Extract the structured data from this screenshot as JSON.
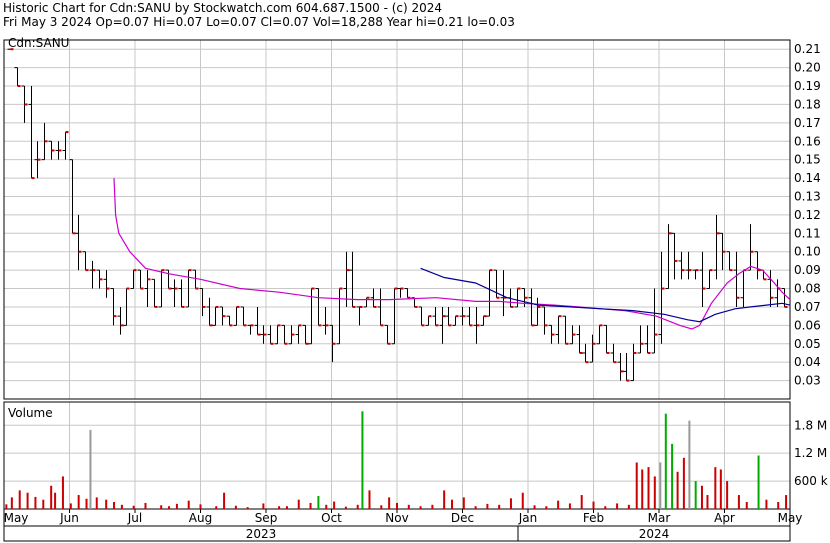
{
  "header": {
    "title": "Historic Chart for Cdn:SANU by Stockwatch.com 604.687.1500 - (c) 2024",
    "summary": "Fri May  3 2024   Op=0.07  Hi=0.07  Lo=0.07  Cl=0.07  Vol=18,288  Year hi=0.21  lo=0.03"
  },
  "chart_data": {
    "type": "ohlc",
    "symbol_label": "Cdn:SANU",
    "volume_label": "Volume",
    "price_ylim": [
      0.02,
      0.215
    ],
    "price_ticks": [
      "0.21",
      "0.20",
      "0.19",
      "0.18",
      "0.17",
      "0.16",
      "0.15",
      "0.14",
      "0.13",
      "0.12",
      "0.11",
      "0.10",
      "0.09",
      "0.08",
      "0.07",
      "0.06",
      "0.05",
      "0.04",
      "0.03"
    ],
    "volume_ticks": [
      "1.8 M",
      "1.2 M",
      "600 k"
    ],
    "volume_ylim": [
      0,
      2300000
    ],
    "month_labels": [
      "May",
      "Jun",
      "Jul",
      "Aug",
      "Sep",
      "Oct",
      "Nov",
      "Dec",
      "Jan",
      "Feb",
      "Mar",
      "Apr",
      "May"
    ],
    "year_labels": [
      "2023",
      "2024"
    ],
    "grid": true,
    "colors": {
      "up": "#000000",
      "down": "#cc0000",
      "ma_short": "#cc00cc",
      "ma_long": "#000099",
      "vol_big": "#00aa00",
      "vol_gray": "#999999",
      "grid": "#c8c8c8"
    },
    "bars": [
      [
        0.21,
        0.21,
        0.21,
        0.21
      ],
      [
        0.2,
        0.2,
        0.19,
        0.19
      ],
      [
        0.19,
        0.19,
        0.17,
        0.18
      ],
      [
        0.18,
        0.19,
        0.14,
        0.14
      ],
      [
        0.15,
        0.16,
        0.14,
        0.15
      ],
      [
        0.15,
        0.17,
        0.15,
        0.16
      ],
      [
        0.16,
        0.16,
        0.15,
        0.155
      ],
      [
        0.155,
        0.16,
        0.15,
        0.155
      ],
      [
        0.155,
        0.165,
        0.15,
        0.165
      ],
      [
        0.15,
        0.15,
        0.11,
        0.11
      ],
      [
        0.11,
        0.12,
        0.09,
        0.1
      ],
      [
        0.1,
        0.1,
        0.09,
        0.09
      ],
      [
        0.09,
        0.095,
        0.08,
        0.09
      ],
      [
        0.09,
        0.09,
        0.08,
        0.085
      ],
      [
        0.085,
        0.09,
        0.075,
        0.08
      ],
      [
        0.08,
        0.08,
        0.06,
        0.065
      ],
      [
        0.065,
        0.07,
        0.055,
        0.06
      ],
      [
        0.06,
        0.08,
        0.06,
        0.08
      ],
      [
        0.08,
        0.09,
        0.08,
        0.09
      ],
      [
        0.09,
        0.09,
        0.08,
        0.08
      ],
      [
        0.08,
        0.09,
        0.07,
        0.085
      ],
      [
        0.085,
        0.085,
        0.07,
        0.07
      ],
      [
        0.07,
        0.09,
        0.07,
        0.09
      ],
      [
        0.09,
        0.09,
        0.08,
        0.08
      ],
      [
        0.08,
        0.085,
        0.07,
        0.08
      ],
      [
        0.08,
        0.085,
        0.07,
        0.07
      ],
      [
        0.07,
        0.09,
        0.07,
        0.09
      ],
      [
        0.09,
        0.09,
        0.08,
        0.08
      ],
      [
        0.08,
        0.08,
        0.065,
        0.07
      ],
      [
        0.07,
        0.075,
        0.06,
        0.06
      ],
      [
        0.06,
        0.07,
        0.06,
        0.07
      ],
      [
        0.07,
        0.07,
        0.06,
        0.065
      ],
      [
        0.065,
        0.065,
        0.06,
        0.06
      ],
      [
        0.06,
        0.07,
        0.06,
        0.07
      ],
      [
        0.07,
        0.07,
        0.06,
        0.06
      ],
      [
        0.06,
        0.06,
        0.055,
        0.06
      ],
      [
        0.06,
        0.07,
        0.055,
        0.055
      ],
      [
        0.055,
        0.06,
        0.05,
        0.055
      ],
      [
        0.055,
        0.06,
        0.05,
        0.05
      ],
      [
        0.05,
        0.06,
        0.05,
        0.06
      ],
      [
        0.06,
        0.06,
        0.05,
        0.05
      ],
      [
        0.05,
        0.06,
        0.05,
        0.055
      ],
      [
        0.055,
        0.06,
        0.05,
        0.06
      ],
      [
        0.06,
        0.06,
        0.05,
        0.05
      ],
      [
        0.05,
        0.08,
        0.05,
        0.08
      ],
      [
        0.08,
        0.08,
        0.06,
        0.06
      ],
      [
        0.06,
        0.07,
        0.055,
        0.06
      ],
      [
        0.06,
        0.06,
        0.04,
        0.05
      ],
      [
        0.05,
        0.08,
        0.05,
        0.08
      ],
      [
        0.08,
        0.1,
        0.07,
        0.09
      ],
      [
        0.09,
        0.1,
        0.07,
        0.07
      ],
      [
        0.07,
        0.07,
        0.06,
        0.07
      ],
      [
        0.07,
        0.075,
        0.07,
        0.075
      ],
      [
        0.075,
        0.08,
        0.07,
        0.07
      ],
      [
        0.07,
        0.08,
        0.06,
        0.06
      ],
      [
        0.06,
        0.06,
        0.05,
        0.05
      ],
      [
        0.05,
        0.08,
        0.05,
        0.08
      ],
      [
        0.08,
        0.08,
        0.075,
        0.08
      ],
      [
        0.08,
        0.08,
        0.075,
        0.075
      ],
      [
        0.075,
        0.075,
        0.07,
        0.07
      ],
      [
        0.07,
        0.07,
        0.06,
        0.06
      ],
      [
        0.06,
        0.065,
        0.06,
        0.065
      ],
      [
        0.065,
        0.07,
        0.06,
        0.06
      ],
      [
        0.06,
        0.07,
        0.05,
        0.065
      ],
      [
        0.065,
        0.07,
        0.06,
        0.06
      ],
      [
        0.06,
        0.065,
        0.06,
        0.065
      ],
      [
        0.065,
        0.07,
        0.06,
        0.065
      ],
      [
        0.065,
        0.07,
        0.06,
        0.06
      ],
      [
        0.06,
        0.07,
        0.05,
        0.06
      ],
      [
        0.06,
        0.065,
        0.06,
        0.065
      ],
      [
        0.065,
        0.09,
        0.065,
        0.09
      ],
      [
        0.09,
        0.09,
        0.075,
        0.075
      ],
      [
        0.075,
        0.09,
        0.065,
        0.075
      ],
      [
        0.075,
        0.08,
        0.07,
        0.07
      ],
      [
        0.07,
        0.08,
        0.07,
        0.08
      ],
      [
        0.08,
        0.08,
        0.07,
        0.075
      ],
      [
        0.075,
        0.08,
        0.06,
        0.06
      ],
      [
        0.06,
        0.075,
        0.06,
        0.07
      ],
      [
        0.07,
        0.07,
        0.055,
        0.06
      ],
      [
        0.06,
        0.06,
        0.05,
        0.055
      ],
      [
        0.055,
        0.065,
        0.05,
        0.065
      ],
      [
        0.065,
        0.065,
        0.05,
        0.05
      ],
      [
        0.05,
        0.06,
        0.05,
        0.055
      ],
      [
        0.055,
        0.06,
        0.045,
        0.045
      ],
      [
        0.045,
        0.05,
        0.04,
        0.04
      ],
      [
        0.04,
        0.055,
        0.04,
        0.05
      ],
      [
        0.05,
        0.06,
        0.05,
        0.06
      ],
      [
        0.06,
        0.06,
        0.045,
        0.045
      ],
      [
        0.045,
        0.05,
        0.04,
        0.04
      ],
      [
        0.04,
        0.045,
        0.03,
        0.035
      ],
      [
        0.035,
        0.045,
        0.03,
        0.03
      ],
      [
        0.03,
        0.05,
        0.03,
        0.045
      ],
      [
        0.045,
        0.06,
        0.045,
        0.05
      ],
      [
        0.05,
        0.06,
        0.045,
        0.045
      ],
      [
        0.045,
        0.08,
        0.045,
        0.055
      ],
      [
        0.055,
        0.1,
        0.05,
        0.08
      ],
      [
        0.08,
        0.115,
        0.08,
        0.11
      ],
      [
        0.11,
        0.11,
        0.085,
        0.095
      ],
      [
        0.095,
        0.1,
        0.085,
        0.09
      ],
      [
        0.09,
        0.1,
        0.085,
        0.09
      ],
      [
        0.09,
        0.09,
        0.085,
        0.09
      ],
      [
        0.09,
        0.1,
        0.07,
        0.08
      ],
      [
        0.08,
        0.09,
        0.08,
        0.09
      ],
      [
        0.09,
        0.12,
        0.085,
        0.11
      ],
      [
        0.11,
        0.11,
        0.09,
        0.1
      ],
      [
        0.1,
        0.1,
        0.09,
        0.09
      ],
      [
        0.09,
        0.1,
        0.07,
        0.075
      ],
      [
        0.075,
        0.09,
        0.07,
        0.09
      ],
      [
        0.09,
        0.115,
        0.09,
        0.1
      ],
      [
        0.1,
        0.1,
        0.085,
        0.09
      ],
      [
        0.09,
        0.09,
        0.085,
        0.085
      ],
      [
        0.085,
        0.09,
        0.07,
        0.075
      ],
      [
        0.075,
        0.085,
        0.07,
        0.08
      ],
      [
        0.08,
        0.08,
        0.07,
        0.07
      ]
    ],
    "ma_short": [
      [
        0.14,
        0.14
      ],
      [
        0.141,
        0.13
      ],
      [
        0.142,
        0.12
      ],
      [
        0.146,
        0.11
      ],
      [
        0.16,
        0.1
      ],
      [
        0.18,
        0.091
      ],
      [
        0.21,
        0.088
      ],
      [
        0.25,
        0.085
      ],
      [
        0.3,
        0.08
      ],
      [
        0.35,
        0.078
      ],
      [
        0.4,
        0.075
      ],
      [
        0.45,
        0.074
      ],
      [
        0.49,
        0.074
      ],
      [
        0.55,
        0.075
      ],
      [
        0.6,
        0.073
      ],
      [
        0.63,
        0.073
      ],
      [
        0.66,
        0.072
      ],
      [
        0.7,
        0.071
      ],
      [
        0.73,
        0.07
      ],
      [
        0.76,
        0.069
      ],
      [
        0.79,
        0.068
      ],
      [
        0.83,
        0.065
      ],
      [
        0.86,
        0.06
      ],
      [
        0.875,
        0.058
      ],
      [
        0.885,
        0.06
      ],
      [
        0.9,
        0.072
      ],
      [
        0.92,
        0.083
      ],
      [
        0.935,
        0.088
      ],
      [
        0.95,
        0.092
      ],
      [
        0.965,
        0.09
      ],
      [
        0.98,
        0.083
      ],
      [
        0.99,
        0.078
      ],
      [
        1.0,
        0.074
      ]
    ],
    "ma_long": [
      [
        0.53,
        0.091
      ],
      [
        0.56,
        0.086
      ],
      [
        0.6,
        0.083
      ],
      [
        0.64,
        0.075
      ],
      [
        0.68,
        0.071
      ],
      [
        0.72,
        0.07
      ],
      [
        0.76,
        0.069
      ],
      [
        0.8,
        0.068
      ],
      [
        0.84,
        0.066
      ],
      [
        0.87,
        0.063
      ],
      [
        0.885,
        0.062
      ],
      [
        0.905,
        0.066
      ],
      [
        0.93,
        0.069
      ],
      [
        0.95,
        0.07
      ],
      [
        0.97,
        0.071
      ],
      [
        0.99,
        0.072
      ],
      [
        1.0,
        0.071
      ]
    ],
    "volume": [
      [
        0.003,
        100000
      ],
      [
        0.01,
        250000
      ],
      [
        0.02,
        400000
      ],
      [
        0.03,
        350000
      ],
      [
        0.04,
        260000
      ],
      [
        0.05,
        200000
      ],
      [
        0.06,
        500000
      ],
      [
        0.065,
        350000
      ],
      [
        0.075,
        700000
      ],
      [
        0.085,
        120000
      ],
      [
        0.095,
        300000
      ],
      [
        0.105,
        220000
      ],
      [
        0.11,
        1700000,
        "gray"
      ],
      [
        0.118,
        250000
      ],
      [
        0.13,
        200000
      ],
      [
        0.14,
        150000
      ],
      [
        0.15,
        90000
      ],
      [
        0.165,
        70000
      ],
      [
        0.18,
        130000
      ],
      [
        0.2,
        80000
      ],
      [
        0.21,
        60000
      ],
      [
        0.22,
        110000
      ],
      [
        0.235,
        180000
      ],
      [
        0.25,
        100000
      ],
      [
        0.27,
        60000
      ],
      [
        0.28,
        350000
      ],
      [
        0.295,
        70000
      ],
      [
        0.31,
        40000
      ],
      [
        0.33,
        120000
      ],
      [
        0.35,
        60000
      ],
      [
        0.36,
        60000
      ],
      [
        0.375,
        200000
      ],
      [
        0.39,
        130000
      ],
      [
        0.4,
        280000,
        "green"
      ],
      [
        0.41,
        90000
      ],
      [
        0.42,
        160000
      ],
      [
        0.435,
        50000
      ],
      [
        0.45,
        90000
      ],
      [
        0.456,
        2100000,
        "green"
      ],
      [
        0.465,
        400000
      ],
      [
        0.48,
        80000
      ],
      [
        0.49,
        250000
      ],
      [
        0.5,
        130000
      ],
      [
        0.515,
        90000
      ],
      [
        0.53,
        60000
      ],
      [
        0.545,
        90000
      ],
      [
        0.56,
        400000
      ],
      [
        0.57,
        200000
      ],
      [
        0.585,
        250000
      ],
      [
        0.6,
        60000
      ],
      [
        0.615,
        110000
      ],
      [
        0.63,
        90000
      ],
      [
        0.645,
        230000
      ],
      [
        0.66,
        350000
      ],
      [
        0.675,
        80000
      ],
      [
        0.69,
        60000
      ],
      [
        0.705,
        180000
      ],
      [
        0.72,
        120000
      ],
      [
        0.735,
        300000
      ],
      [
        0.75,
        160000
      ],
      [
        0.765,
        60000
      ],
      [
        0.78,
        120000
      ],
      [
        0.795,
        90000
      ],
      [
        0.805,
        1000000
      ],
      [
        0.812,
        850000
      ],
      [
        0.82,
        900000
      ],
      [
        0.828,
        700000
      ],
      [
        0.835,
        1000000,
        "gray"
      ],
      [
        0.842,
        2050000,
        "green"
      ],
      [
        0.85,
        1400000,
        "green"
      ],
      [
        0.857,
        800000
      ],
      [
        0.865,
        1100000
      ],
      [
        0.872,
        1900000,
        "gray"
      ],
      [
        0.88,
        600000,
        "green"
      ],
      [
        0.888,
        500000
      ],
      [
        0.895,
        300000
      ],
      [
        0.905,
        900000
      ],
      [
        0.912,
        850000
      ],
      [
        0.92,
        600000
      ],
      [
        0.935,
        300000
      ],
      [
        0.945,
        150000
      ],
      [
        0.96,
        1150000,
        "green"
      ],
      [
        0.97,
        200000
      ],
      [
        0.985,
        150000
      ],
      [
        0.995,
        300000
      ]
    ]
  }
}
